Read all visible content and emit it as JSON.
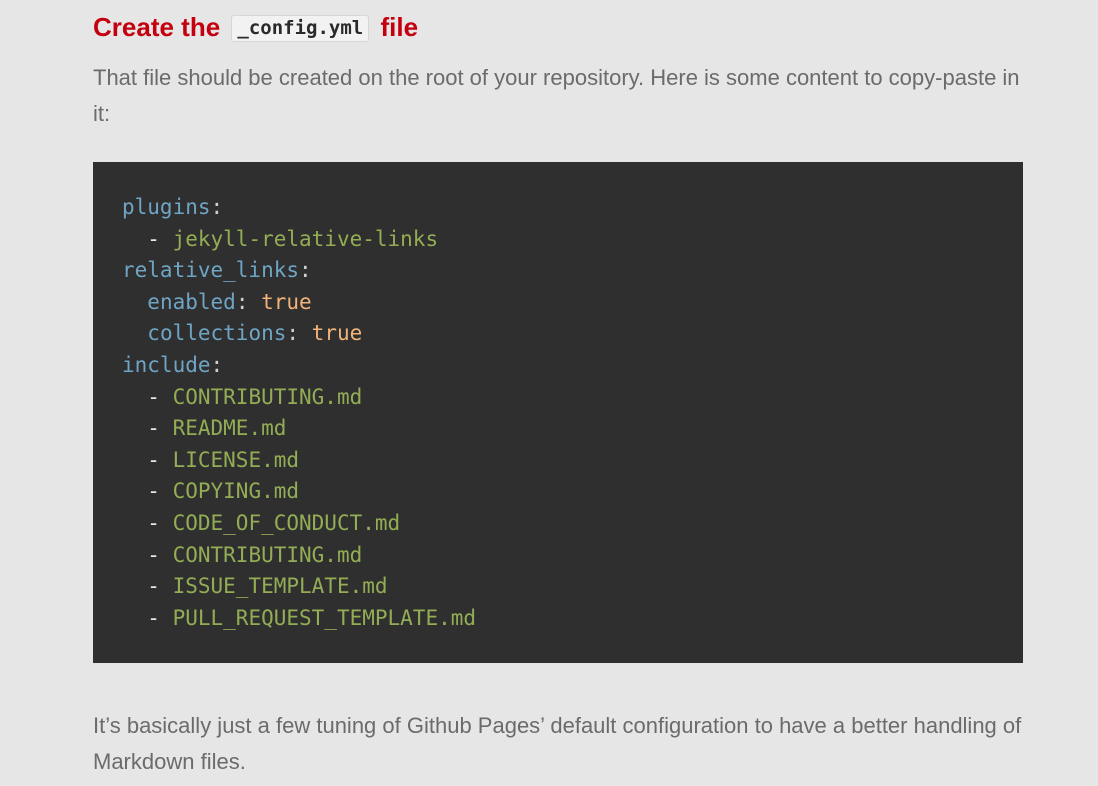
{
  "heading": {
    "before": "Create the ",
    "code": "_config.yml",
    "after": " file",
    "color": "#c5000e"
  },
  "intro": "That file should be created on the root of your repository. Here is some content to copy-paste in it:",
  "code": {
    "background": "#2f2f2f",
    "key_color": "#6fa5c4",
    "string_color": "#93ad55",
    "boolean_color": "#f2b37a",
    "lines": [
      {
        "indent": "",
        "key": "plugins",
        "punct": ":"
      },
      {
        "indent": "  ",
        "dash": "- ",
        "str": "jekyll-relative-links"
      },
      {
        "indent": "",
        "key": "relative_links",
        "punct": ":"
      },
      {
        "indent": "  ",
        "key": "enabled",
        "punct": ": ",
        "bool": "true"
      },
      {
        "indent": "  ",
        "key": "collections",
        "punct": ": ",
        "bool": "true"
      },
      {
        "indent": "",
        "key": "include",
        "punct": ":"
      },
      {
        "indent": "  ",
        "dash": "- ",
        "str": "CONTRIBUTING.md"
      },
      {
        "indent": "  ",
        "dash": "- ",
        "str": "README.md"
      },
      {
        "indent": "  ",
        "dash": "- ",
        "str": "LICENSE.md"
      },
      {
        "indent": "  ",
        "dash": "- ",
        "str": "COPYING.md"
      },
      {
        "indent": "  ",
        "dash": "- ",
        "str": "CODE_OF_CONDUCT.md"
      },
      {
        "indent": "  ",
        "dash": "- ",
        "str": "CONTRIBUTING.md"
      },
      {
        "indent": "  ",
        "dash": "- ",
        "str": "ISSUE_TEMPLATE.md"
      },
      {
        "indent": "  ",
        "dash": "- ",
        "str": "PULL_REQUEST_TEMPLATE.md"
      }
    ]
  },
  "outro": "It’s basically just a few tuning of Github Pages’ default configuration to have a better handling of Markdown files."
}
